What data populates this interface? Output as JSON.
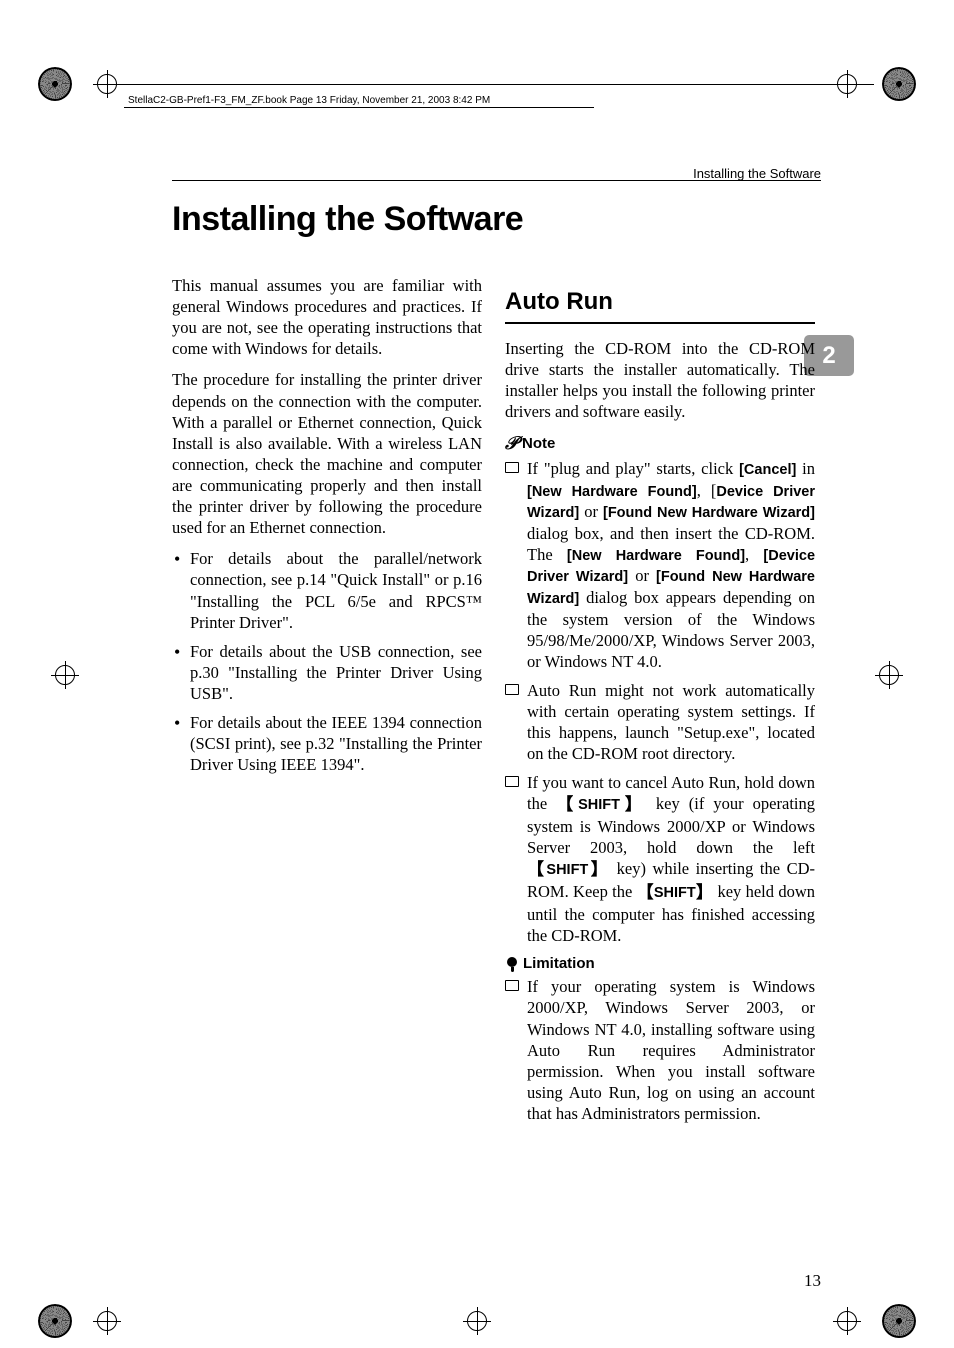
{
  "crop_header": "StellaC2-GB-Pref1-F3_FM_ZF.book  Page 13  Friday, November 21, 2003  8:42 PM",
  "running_head": "Installing the Software",
  "title": "Installing the Software",
  "side_tab": "2",
  "left": {
    "p1": "This manual assumes you are familiar with general Windows procedures and practices. If you are not, see the operating instructions that come with Windows for details.",
    "p2": "The procedure for installing the printer driver depends on the connection with the computer. With a parallel or Ethernet connection, Quick Install is also available. With a wireless LAN connection, check the machine and computer are communicating properly and then install the printer driver by following the procedure used for an Ethernet connection.",
    "b1": "For details about the parallel/network connection, see p.14 \"Quick Install\" or p.16 \"Installing the PCL 6/5e and RPCS™ Printer Driver\".",
    "b2": "For details about the USB connection, see p.30 \"Installing the Printer Driver Using USB\".",
    "b3": "For details about the IEEE 1394 connection (SCSI print), see p.32 \"Installing the Printer Driver Using IEEE 1394\"."
  },
  "right": {
    "h2": "Auto Run",
    "intro": "Inserting the CD-ROM into the CD-ROM drive starts the installer automatically. The installer helps you install the following printer drivers and software easily.",
    "note_label": "Note",
    "n1_a": "If \"plug and play\" starts, click ",
    "n1_cancel": "[Cancel]",
    "n1_b": " in ",
    "n1_nhf": "[New Hardware Found]",
    "n1_c": ", [",
    "n1_ddw": "Device Driver Wizard]",
    "n1_d": " or ",
    "n1_fnhw": "[Found New Hardware Wizard]",
    "n1_e": " dialog box, and then insert the CD-ROM. The ",
    "n1_nhf2": "[New Hardware Found]",
    "n1_f": ", ",
    "n1_ddw2": "[Device Driver Wizard]",
    "n1_g": " or ",
    "n1_fnhw2": "[Found New Hardware Wizard]",
    "n1_h": " dialog box appears depending on the system version of the Windows 95/98/Me/2000/XP, Windows Server 2003, or Windows NT 4.0.",
    "n2": "Auto Run might not work automatically with certain operating system settings. If this happens, launch \"Setup.exe\", located on the CD-ROM root directory.",
    "n3_a": "If you want to cancel Auto Run, hold down the ",
    "n3_shift": "SHIFT",
    "n3_b": " key (if your operating system is Windows 2000/XP or Windows Server 2003, hold down the left ",
    "n3_c": " key) while inserting the CD-ROM. Keep the ",
    "n3_d": " key held down until the computer has finished accessing the CD-ROM.",
    "limit_label": "Limitation",
    "l1": "If your operating system is Windows 2000/XP, Windows Server 2003, or Windows NT 4.0, installing software using Auto Run requires Administrator permission. When you install software using Auto Run, log on using an account that has Administrators permission."
  },
  "page_number": "13"
}
